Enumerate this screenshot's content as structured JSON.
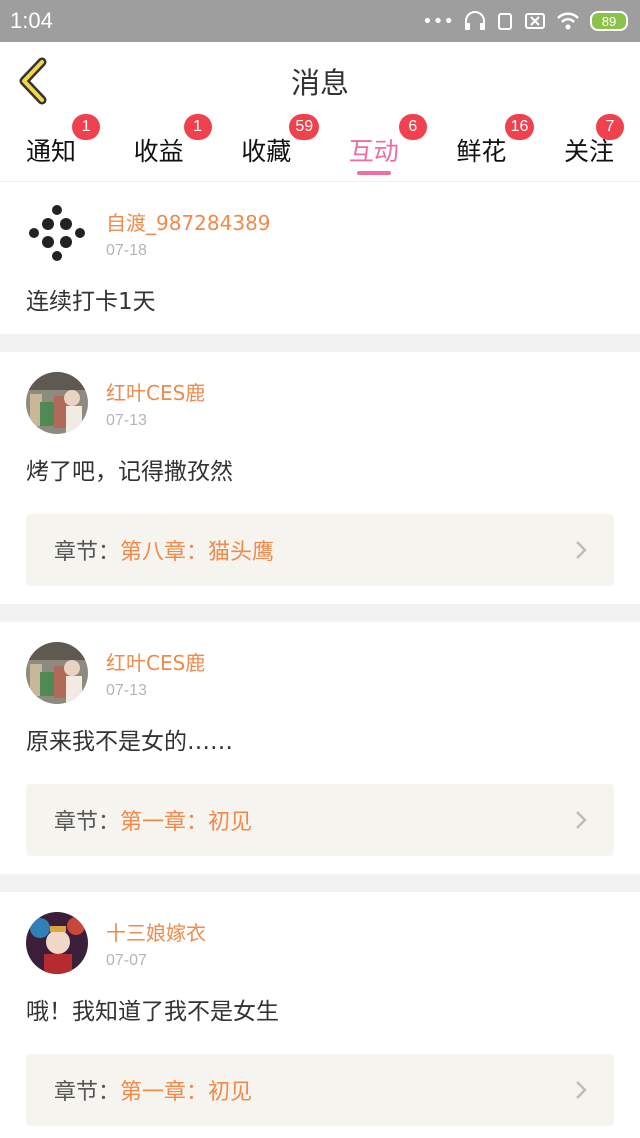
{
  "status_bar": {
    "time": "1:04",
    "battery": "89"
  },
  "header": {
    "title": "消息"
  },
  "tabs": [
    {
      "label": "通知",
      "badge": "1"
    },
    {
      "label": "收益",
      "badge": "1"
    },
    {
      "label": "收藏",
      "badge": "59"
    },
    {
      "label": "互动",
      "badge": "6",
      "active": true
    },
    {
      "label": "鲜花",
      "badge": "16"
    },
    {
      "label": "关注",
      "badge": "7"
    }
  ],
  "messages": [
    {
      "username": "自渡_987284389",
      "date": "07-18",
      "text": "连续打卡1天"
    },
    {
      "username": "红叶CES鹿",
      "date": "07-13",
      "text": "烤了吧，记得撒孜然",
      "chapter_label": "章节：",
      "chapter_title": "第八章：猫头鹰"
    },
    {
      "username": "红叶CES鹿",
      "date": "07-13",
      "text": "原来我不是女的……",
      "chapter_label": "章节：",
      "chapter_title": "第一章：初见"
    },
    {
      "username": "十三娘嫁衣",
      "date": "07-07",
      "text": "哦！我知道了我不是女生",
      "chapter_label": "章节：",
      "chapter_title": "第一章：初见"
    }
  ],
  "colors": {
    "accent": "#ef6d9f",
    "username": "#f08a4b",
    "badge": "#f0424e"
  },
  "icons": [
    "back-chevron-icon",
    "chevron-right-icon",
    "battery-icon",
    "wifi-icon",
    "headphone-icon"
  ]
}
